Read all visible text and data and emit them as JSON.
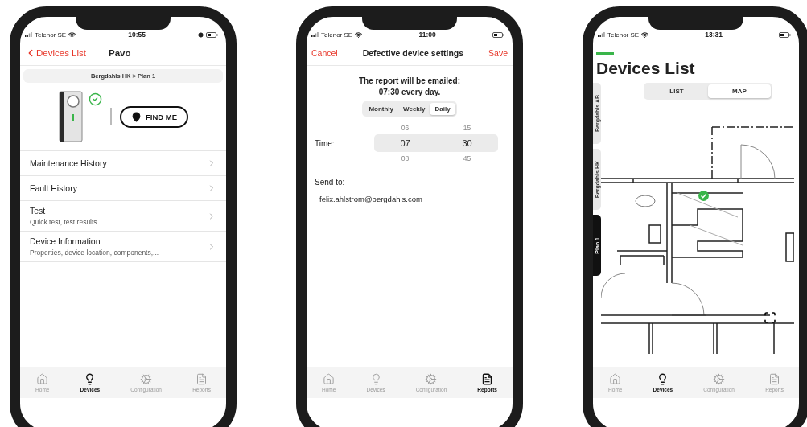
{
  "phones": [
    {
      "kind": "device",
      "status_bar": {
        "carrier": "Telenor SE",
        "time": "10:55"
      },
      "nav": {
        "back": "Devices List",
        "title": "Pavo"
      },
      "breadcrumb": "Bergdahls HK > Plan 1",
      "find_button": "FIND ME",
      "menu": [
        {
          "title": "Maintenance History"
        },
        {
          "title": "Fault History"
        },
        {
          "title": "Test",
          "subtitle": "Quick test, test results"
        },
        {
          "title": "Device Information",
          "subtitle": "Properties, device location, components,..."
        }
      ],
      "tab_bar": [
        {
          "kind": "home",
          "label": "Home",
          "selected": false
        },
        {
          "kind": "devices",
          "label": "Devices",
          "selected": true
        },
        {
          "kind": "configuration",
          "label": "Configuration",
          "selected": false
        },
        {
          "kind": "reports",
          "label": "Reports",
          "selected": false
        }
      ]
    },
    {
      "kind": "report",
      "status_bar": {
        "carrier": "Telenor SE",
        "time": "11:00"
      },
      "nav": {
        "cancel": "Cancel",
        "title": "Defective device settings",
        "save": "Save"
      },
      "summary": [
        "The report will be emailed:",
        "07:30 every day."
      ],
      "frequency": [
        {
          "label": "Monthly",
          "selected": false
        },
        {
          "label": "Weekly",
          "selected": false
        },
        {
          "label": "Daily",
          "selected": true
        }
      ],
      "time": {
        "label": "Time:",
        "columns": [
          {
            "above": "06",
            "value": "07",
            "below": "08"
          },
          {
            "above": "15",
            "value": "30",
            "below": "45"
          }
        ]
      },
      "send_to": {
        "label": "Send to:",
        "value": "felix.ahlstrom@bergdahls.com"
      },
      "tab_bar": [
        {
          "kind": "home",
          "label": "Home",
          "selected": false
        },
        {
          "kind": "devices",
          "label": "Devices",
          "selected": false
        },
        {
          "kind": "configuration",
          "label": "Configuration",
          "selected": false
        },
        {
          "kind": "reports",
          "label": "Reports",
          "selected": true
        }
      ]
    },
    {
      "kind": "map",
      "status_bar": {
        "carrier": "Telenor SE",
        "time": "13:31"
      },
      "title": "Devices List",
      "view_toggle": [
        {
          "label": "LIST",
          "selected": false
        },
        {
          "label": "MAP",
          "selected": true
        }
      ],
      "side_tabs": [
        {
          "label": "Bergdahls AB",
          "selected": false
        },
        {
          "label": "Bergdahls HK",
          "selected": false
        },
        {
          "label": "Plan 1",
          "selected": true
        }
      ],
      "tab_bar": [
        {
          "kind": "home",
          "label": "Home",
          "selected": false
        },
        {
          "kind": "devices",
          "label": "Devices",
          "selected": true
        },
        {
          "kind": "configuration",
          "label": "Configuration",
          "selected": false
        },
        {
          "kind": "reports",
          "label": "Reports",
          "selected": false
        }
      ]
    }
  ]
}
